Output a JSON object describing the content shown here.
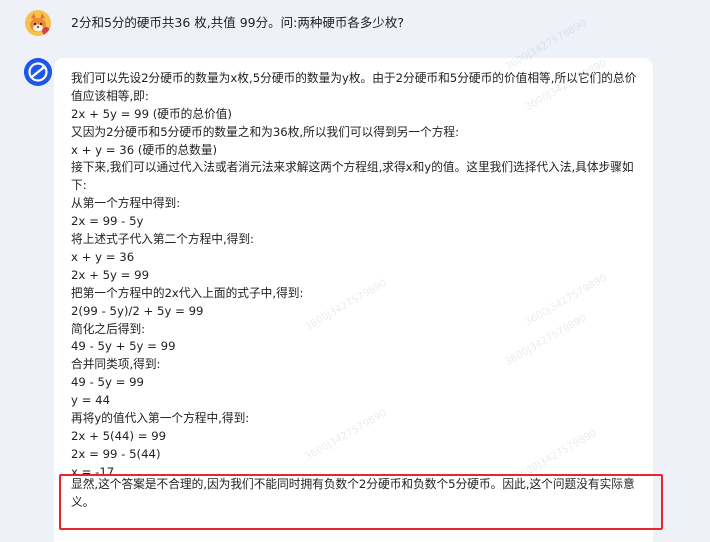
{
  "user_message": {
    "text": "2分和5分的硬币共36 枚,共值 99分。问:两种硬币各多少枚?"
  },
  "assistant_message": {
    "lines": [
      "我们可以先设2分硬币的数量为x枚,5分硬币的数量为y枚。由于2分硬币和5分硬币的价值相等,所以它们的总价值应该相等,即:",
      "2x + 5y = 99 (硬币的总价值)",
      "又因为2分硬币和5分硬币的数量之和为36枚,所以我们可以得到另一个方程:",
      "x + y = 36 (硬币的总数量)",
      "接下来,我们可以通过代入法或者消元法来求解这两个方程组,求得x和y的值。这里我们选择代入法,具体步骤如下:",
      "从第一个方程中得到:",
      "2x = 99 - 5y",
      "将上述式子代入第二个方程中,得到:",
      "x + y = 36",
      "2x + 5y = 99",
      "把第一个方程中的2x代入上面的式子中,得到:",
      "2(99 - 5y)/2 + 5y = 99",
      "简化之后得到:",
      "49 - 5y + 5y = 99",
      "合并同类项,得到:",
      "49 - 5y = 99",
      "y = 44",
      "再将y的值代入第一个方程中,得到:",
      "2x + 5(44) = 99",
      "2x = 99 - 5(44)",
      "x = -17",
      "显然,这个答案是不合理的,因为我们不能同时拥有负数个2分硬币和负数个5分硬币。因此,这个问题没有实际意义。"
    ]
  },
  "watermark": {
    "text": "3600J3427579890"
  },
  "colors": {
    "background": "#eef1f7",
    "bubble": "#ffffff",
    "highlight_border": "#e3282e",
    "bot_avatar": "#1f57e7",
    "user_avatar": "#f4c35b"
  }
}
